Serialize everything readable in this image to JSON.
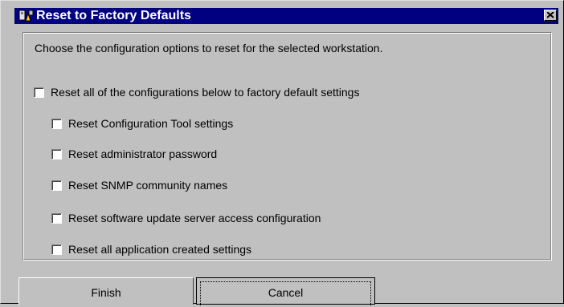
{
  "window": {
    "title": "Reset to Factory Defaults",
    "icon": "app-icon",
    "close_icon": "close-icon"
  },
  "panel": {
    "instruction": "Choose the configuration options to reset for the selected workstation.",
    "options": [
      {
        "label": "Reset all of the configurations below to factory default settings",
        "checked": false
      },
      {
        "label": "Reset Configuration Tool settings",
        "checked": false
      },
      {
        "label": "Reset administrator password",
        "checked": false
      },
      {
        "label": "Reset SNMP community names",
        "checked": false
      },
      {
        "label": "Reset software update server access configuration",
        "checked": false
      },
      {
        "label": "Reset all application created settings",
        "checked": false
      }
    ]
  },
  "buttons": {
    "finish": "Finish",
    "cancel": "Cancel"
  }
}
